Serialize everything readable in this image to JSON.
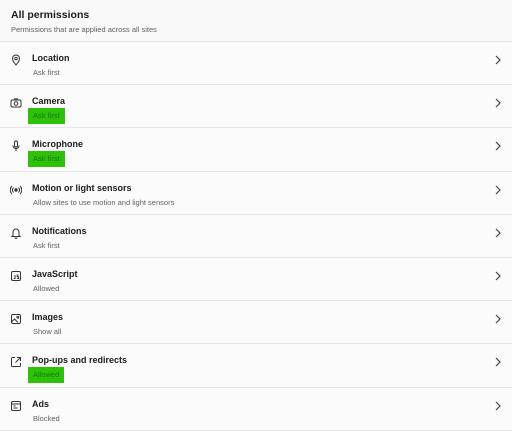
{
  "header": {
    "title": "All permissions",
    "subtitle": "Permissions that are applied across all sites"
  },
  "permissions": [
    {
      "label": "Location",
      "desc": "Ask first",
      "icon": "location-pin-icon",
      "highlighted": false
    },
    {
      "label": "Camera",
      "desc": "Ask first",
      "icon": "camera-icon",
      "highlighted": true
    },
    {
      "label": "Microphone",
      "desc": "Ask first",
      "icon": "microphone-icon",
      "highlighted": true
    },
    {
      "label": "Motion or light sensors",
      "desc": "Allow sites to use motion and light sensors",
      "icon": "sensor-icon",
      "highlighted": false
    },
    {
      "label": "Notifications",
      "desc": "Ask first",
      "icon": "bell-icon",
      "highlighted": false
    },
    {
      "label": "JavaScript",
      "desc": "Allowed",
      "icon": "javascript-icon",
      "highlighted": false
    },
    {
      "label": "Images",
      "desc": "Show all",
      "icon": "image-icon",
      "highlighted": false
    },
    {
      "label": "Pop-ups and redirects",
      "desc": "Allowed",
      "icon": "popup-icon",
      "highlighted": true
    },
    {
      "label": "Ads",
      "desc": "Blocked",
      "icon": "ads-icon",
      "highlighted": false
    }
  ],
  "colors": {
    "highlight": "#2ec10a",
    "highlight_text": "#177a00"
  }
}
